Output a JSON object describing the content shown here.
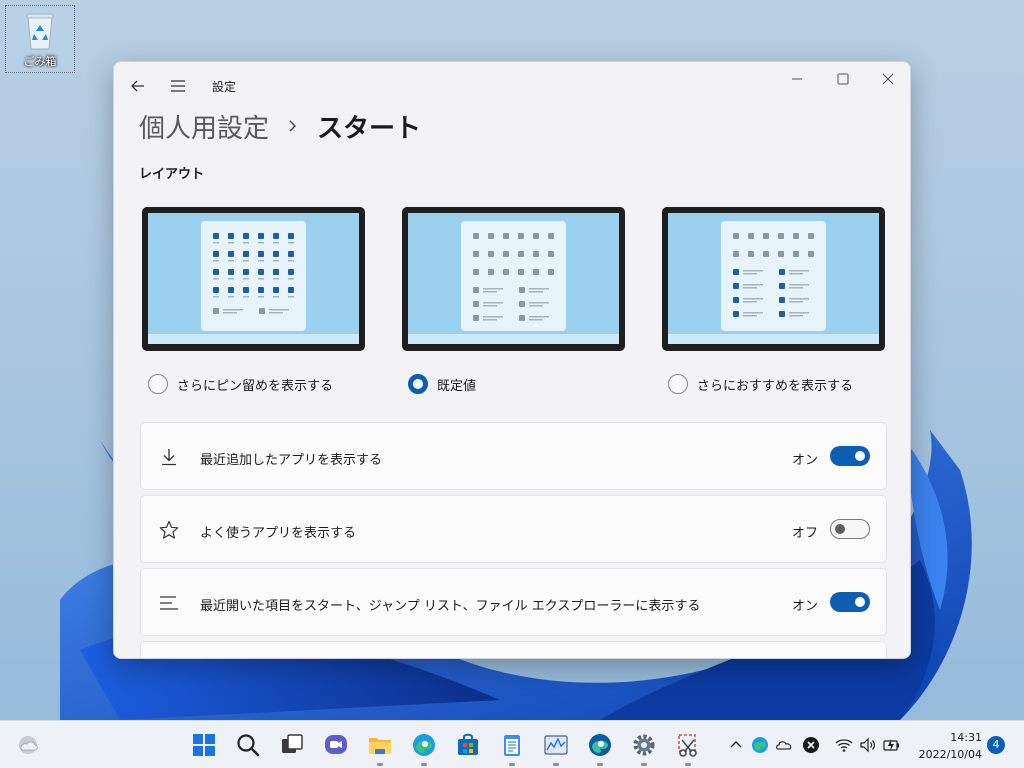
{
  "desktop": {
    "recycle_bin_label": "ごみ箱"
  },
  "window": {
    "title": "設定",
    "breadcrumb": {
      "parent": "個人用設定",
      "current": "スタート"
    },
    "section_label": "レイアウト",
    "layouts": [
      {
        "label": "さらにピン留めを表示する",
        "selected": false
      },
      {
        "label": "既定値",
        "selected": true
      },
      {
        "label": "さらにおすすめを表示する",
        "selected": false
      }
    ],
    "settings": [
      {
        "icon": "download-icon",
        "label": "最近追加したアプリを表示する",
        "state": "オン",
        "on": true
      },
      {
        "icon": "star-icon",
        "label": "よく使うアプリを表示する",
        "state": "オフ",
        "on": false
      },
      {
        "icon": "list-lines-icon",
        "label": "最近開いた項目をスタート、ジャンプ リスト、ファイル エクスプローラーに表示する",
        "state": "オン",
        "on": true
      }
    ]
  },
  "taskbar": {
    "time": "14:31",
    "date": "2022/10/04",
    "notification_count": "4"
  },
  "colors": {
    "accent": "#0d5fb4",
    "preview_bg": "#9bd1ee",
    "preview_dark_tile": "#1d5ea8"
  }
}
